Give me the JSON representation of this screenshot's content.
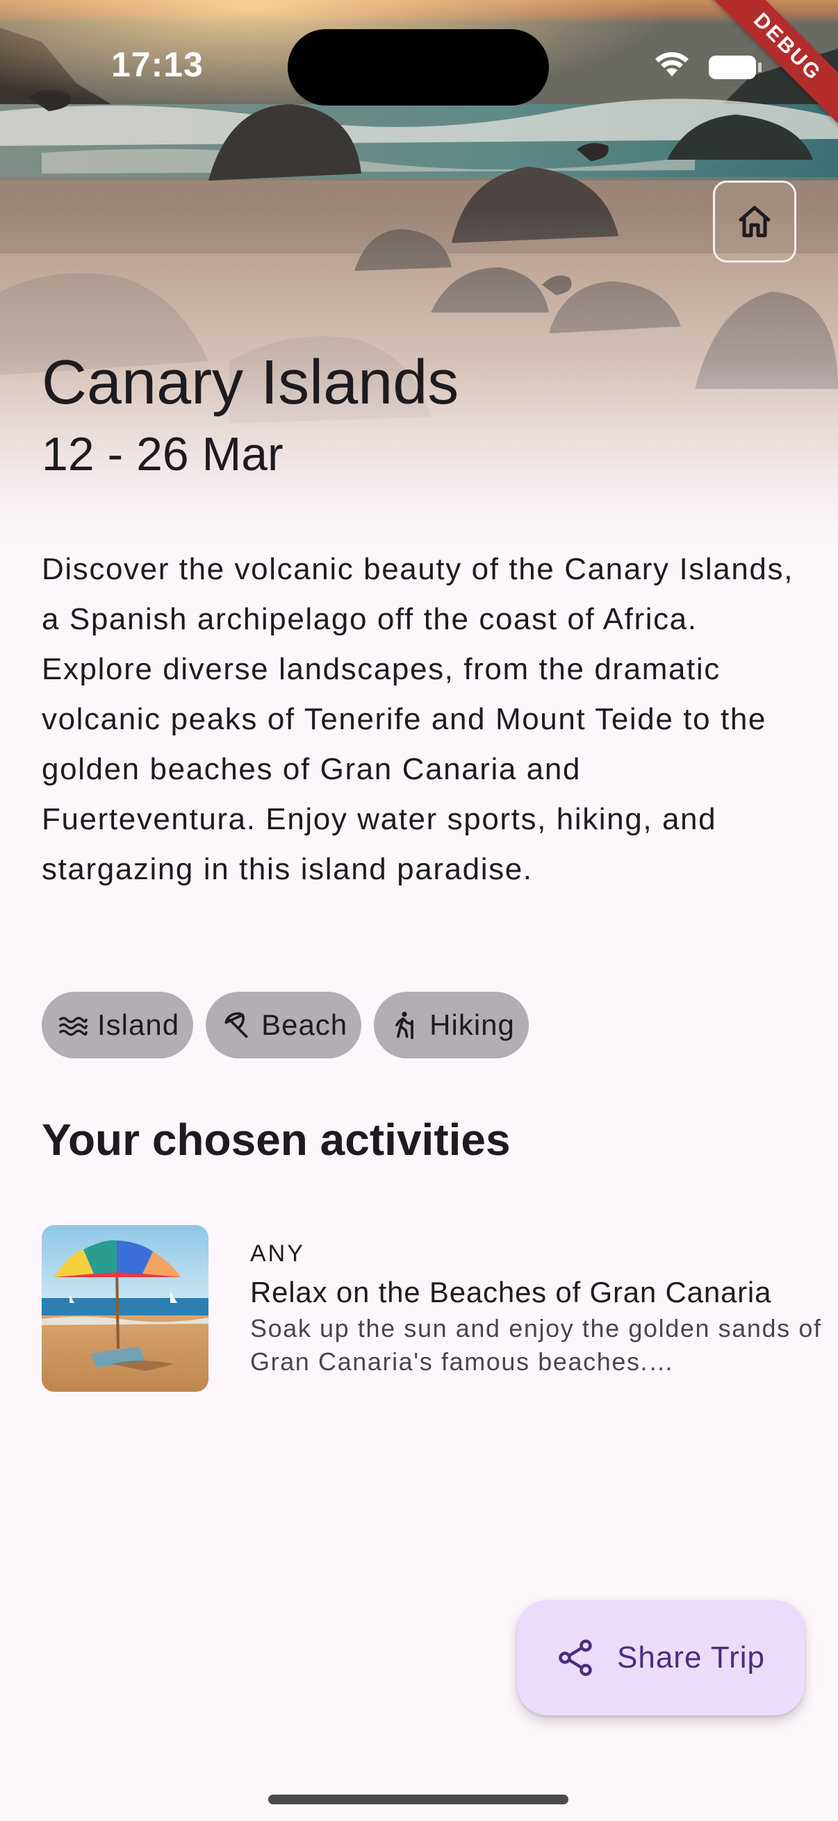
{
  "status_bar": {
    "time": "17:13"
  },
  "debug_banner": "DEBUG",
  "header": {
    "home_icon": "home-icon",
    "title": "Canary Islands",
    "dates": "12 - 26 Mar"
  },
  "description": "Discover the volcanic beauty of the Canary Islands, a Spanish archipelago off the coast of Africa.  Explore diverse landscapes, from the dramatic volcanic peaks of Tenerife and Mount Teide to the golden beaches of Gran Canaria and Fuerteventura.  Enjoy water sports, hiking, and stargazing in this island paradise.",
  "tags": [
    {
      "label": "Island",
      "icon": "waves-icon"
    },
    {
      "label": "Beach",
      "icon": "beach-umbrella-icon"
    },
    {
      "label": "Hiking",
      "icon": "hiking-icon"
    }
  ],
  "activities_section": {
    "title": "Your chosen activities",
    "items": [
      {
        "kind": "ANY",
        "name": "Relax on the Beaches of Gran Canaria",
        "description": "Soak up the sun and enjoy the golden sands of Gran Canaria's famous beaches.…"
      }
    ]
  },
  "fab": {
    "label": "Share Trip",
    "icon": "share-icon"
  },
  "colors": {
    "background": "#fdf7fc",
    "chip": "#b3aeb5",
    "fab": "#eadcfa",
    "fab_text": "#4a2d80",
    "debug": "#b42d2d"
  }
}
